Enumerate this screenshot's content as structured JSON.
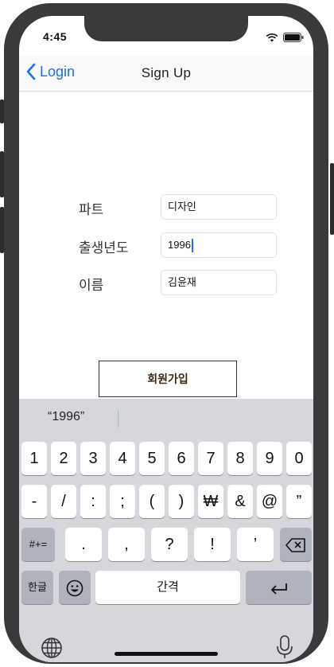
{
  "status_bar": {
    "time": "4:45"
  },
  "navbar": {
    "back_label": "Login",
    "title": "Sign Up"
  },
  "form": {
    "part": {
      "label": "파트",
      "value": "디자인"
    },
    "birth_year": {
      "label": "출생년도",
      "value": "1996"
    },
    "name": {
      "label": "이름",
      "value": "김윤재"
    }
  },
  "signup_button": {
    "label": "회원가입"
  },
  "keyboard": {
    "suggestion": "“1996”",
    "row1": [
      "1",
      "2",
      "3",
      "4",
      "5",
      "6",
      "7",
      "8",
      "9",
      "0"
    ],
    "row2": [
      "-",
      "/",
      ":",
      ";",
      "(",
      ")",
      "₩",
      "&",
      "@",
      "”"
    ],
    "row3": [
      ".",
      ",",
      "?",
      "!",
      "’"
    ],
    "toggle_label": "#+=",
    "lang_label": "한글",
    "space_label": "간격"
  },
  "colors": {
    "accent": "#1a73e8",
    "keyboard_bg": "#d5d7dd",
    "dark_key": "#aeb3bd"
  }
}
